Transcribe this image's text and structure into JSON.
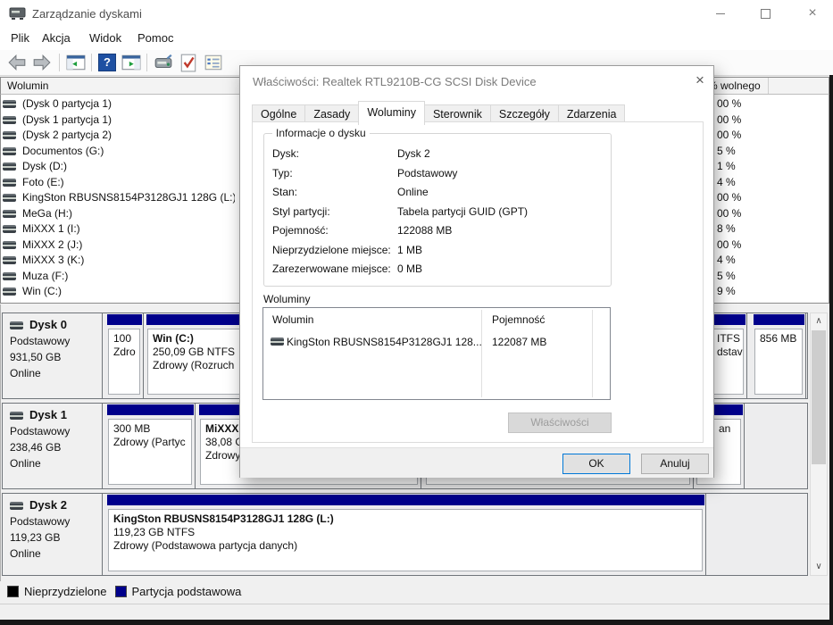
{
  "window": {
    "title": "Zarządzanie dyskami",
    "close_glyph": "×"
  },
  "menu": {
    "items": [
      "Plik",
      "Akcja",
      "Widok",
      "Pomoc"
    ]
  },
  "toolbar": {
    "icons": [
      "back-icon",
      "forward-icon",
      "console-tree-icon",
      "help-icon",
      "action-pane-icon",
      "rescan-disks-icon",
      "check-document-icon",
      "properties-list-icon"
    ],
    "help_glyph": "?"
  },
  "volume_list": {
    "header": "Wolumin",
    "free_header": "% wolnego",
    "rows": [
      {
        "name": "(Dysk 0 partycja 1)",
        "free": "00 %"
      },
      {
        "name": "(Dysk 1 partycja 1)",
        "free": "00 %"
      },
      {
        "name": "(Dysk 2 partycja 2)",
        "free": "00 %"
      },
      {
        "name": "Documentos (G:)",
        "free": "5 %"
      },
      {
        "name": "Dysk (D:)",
        "free": "1 %"
      },
      {
        "name": "Foto (E:)",
        "free": "4 %"
      },
      {
        "name": "KingSton RBUSNS8154P3128GJ1 128G (L:)",
        "free": "00 %"
      },
      {
        "name": "MeGa (H:)",
        "free": "00 %"
      },
      {
        "name": "MiXXX 1 (I:)",
        "free": "8 %"
      },
      {
        "name": "MiXXX 2 (J:)",
        "free": "00 %"
      },
      {
        "name": "MiXXX 3 (K:)",
        "free": "4 %"
      },
      {
        "name": "Muza (F:)",
        "free": "5 %"
      },
      {
        "name": "Win (C:)",
        "free": "9 %"
      }
    ]
  },
  "disks": [
    {
      "name": "Dysk 0",
      "type": "Podstawowy",
      "size": "931,50 GB",
      "status": "Online",
      "partitions": [
        {
          "lines": [
            "100",
            "Zdro"
          ]
        },
        {
          "lines": [
            "Win  (C:)",
            "250,09 GB NTFS",
            "Zdrowy (Rozruch"
          ]
        },
        {
          "lines": [
            "ITFS",
            "dstav"
          ]
        },
        {
          "lines": [
            "856 MB"
          ]
        }
      ]
    },
    {
      "name": "Dysk 1",
      "type": "Podstawowy",
      "size": "238,46 GB",
      "status": "Online",
      "partitions": [
        {
          "lines": [
            "300 MB",
            "Zdrowy (Partyc"
          ]
        },
        {
          "lines": [
            "MiXXX",
            "38,08 G",
            "Zdrowy"
          ]
        },
        {
          "lines": [
            "",
            ""
          ]
        },
        {
          "lines": [
            "an"
          ]
        }
      ]
    },
    {
      "name": "Dysk 2",
      "type": "Podstawowy",
      "size": "119,23 GB",
      "status": "Online",
      "partitions": [
        {
          "lines": [
            "KingSton RBUSNS8154P3128GJ1 128G  (L:)",
            "119,23 GB NTFS",
            "Zdrowy (Podstawowa partycja danych)"
          ]
        }
      ]
    }
  ],
  "graph_legend": [
    {
      "label": "Nieprzydzielone",
      "color": "#000000"
    },
    {
      "label": "Partycja podstawowa",
      "color": "#00008b"
    }
  ],
  "colors": {
    "partition_bar": "#00008b"
  },
  "dialog": {
    "title": "Właściwości: Realtek RTL9210B-CG SCSI Disk Device",
    "close_glyph": "×",
    "tabs": [
      "Ogólne",
      "Zasady",
      "Woluminy",
      "Sterownik",
      "Szczegóły",
      "Zdarzenia"
    ],
    "active_tab": "Woluminy",
    "group_title": "Informacje o dysku",
    "info_fields": [
      {
        "label": "Dysk:",
        "value": "Dysk 2"
      },
      {
        "label": "Typ:",
        "value": "Podstawowy"
      },
      {
        "label": "Stan:",
        "value": "Online"
      },
      {
        "label": "Styl partycji:",
        "value": "Tabela partycji GUID (GPT)"
      },
      {
        "label": "Pojemność:",
        "value": "122088 MB"
      },
      {
        "label": "Nieprzydzielone miejsce:",
        "value": "1 MB"
      },
      {
        "label": "Zarezerwowane miejsce:",
        "value": "0 MB"
      }
    ],
    "volumes_label": "Woluminy",
    "list": {
      "columns": [
        "Wolumin",
        "Pojemność"
      ],
      "rows": [
        {
          "volume": "KingSton RBUSNS8154P3128GJ1 128...",
          "capacity": "122087 MB"
        }
      ]
    },
    "properties_button": "Właściwości",
    "ok": "OK",
    "cancel": "Anuluj"
  }
}
